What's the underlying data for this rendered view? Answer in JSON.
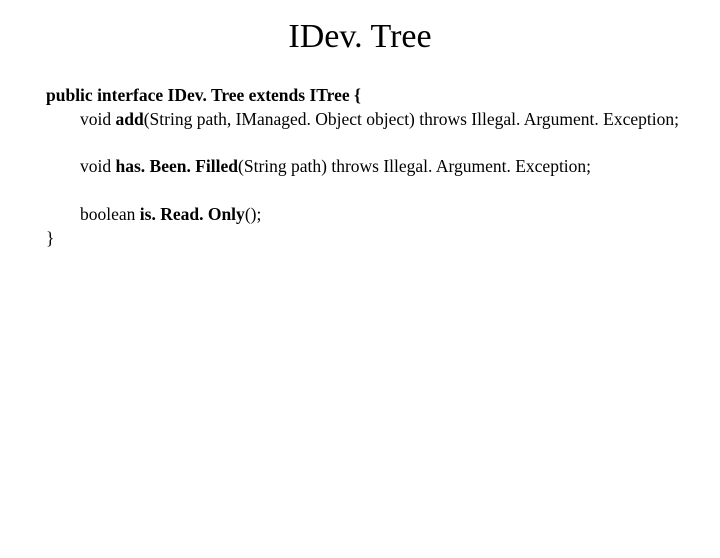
{
  "title": "IDev. Tree",
  "line1": {
    "t1": "public interface IDev. Tree extends ITree {"
  },
  "line2": {
    "pre": "void ",
    "method": "add",
    "post": "(String path, IManaged. Object object) throws Illegal. Argument. Exception;"
  },
  "line3": {
    "pre": "void ",
    "method": "has. Been. Filled",
    "post": "(String path) throws Illegal. Argument. Exception;"
  },
  "line4": {
    "pre": "boolean ",
    "method": "is. Read. Only",
    "post": "();"
  },
  "closeBrace": "}"
}
